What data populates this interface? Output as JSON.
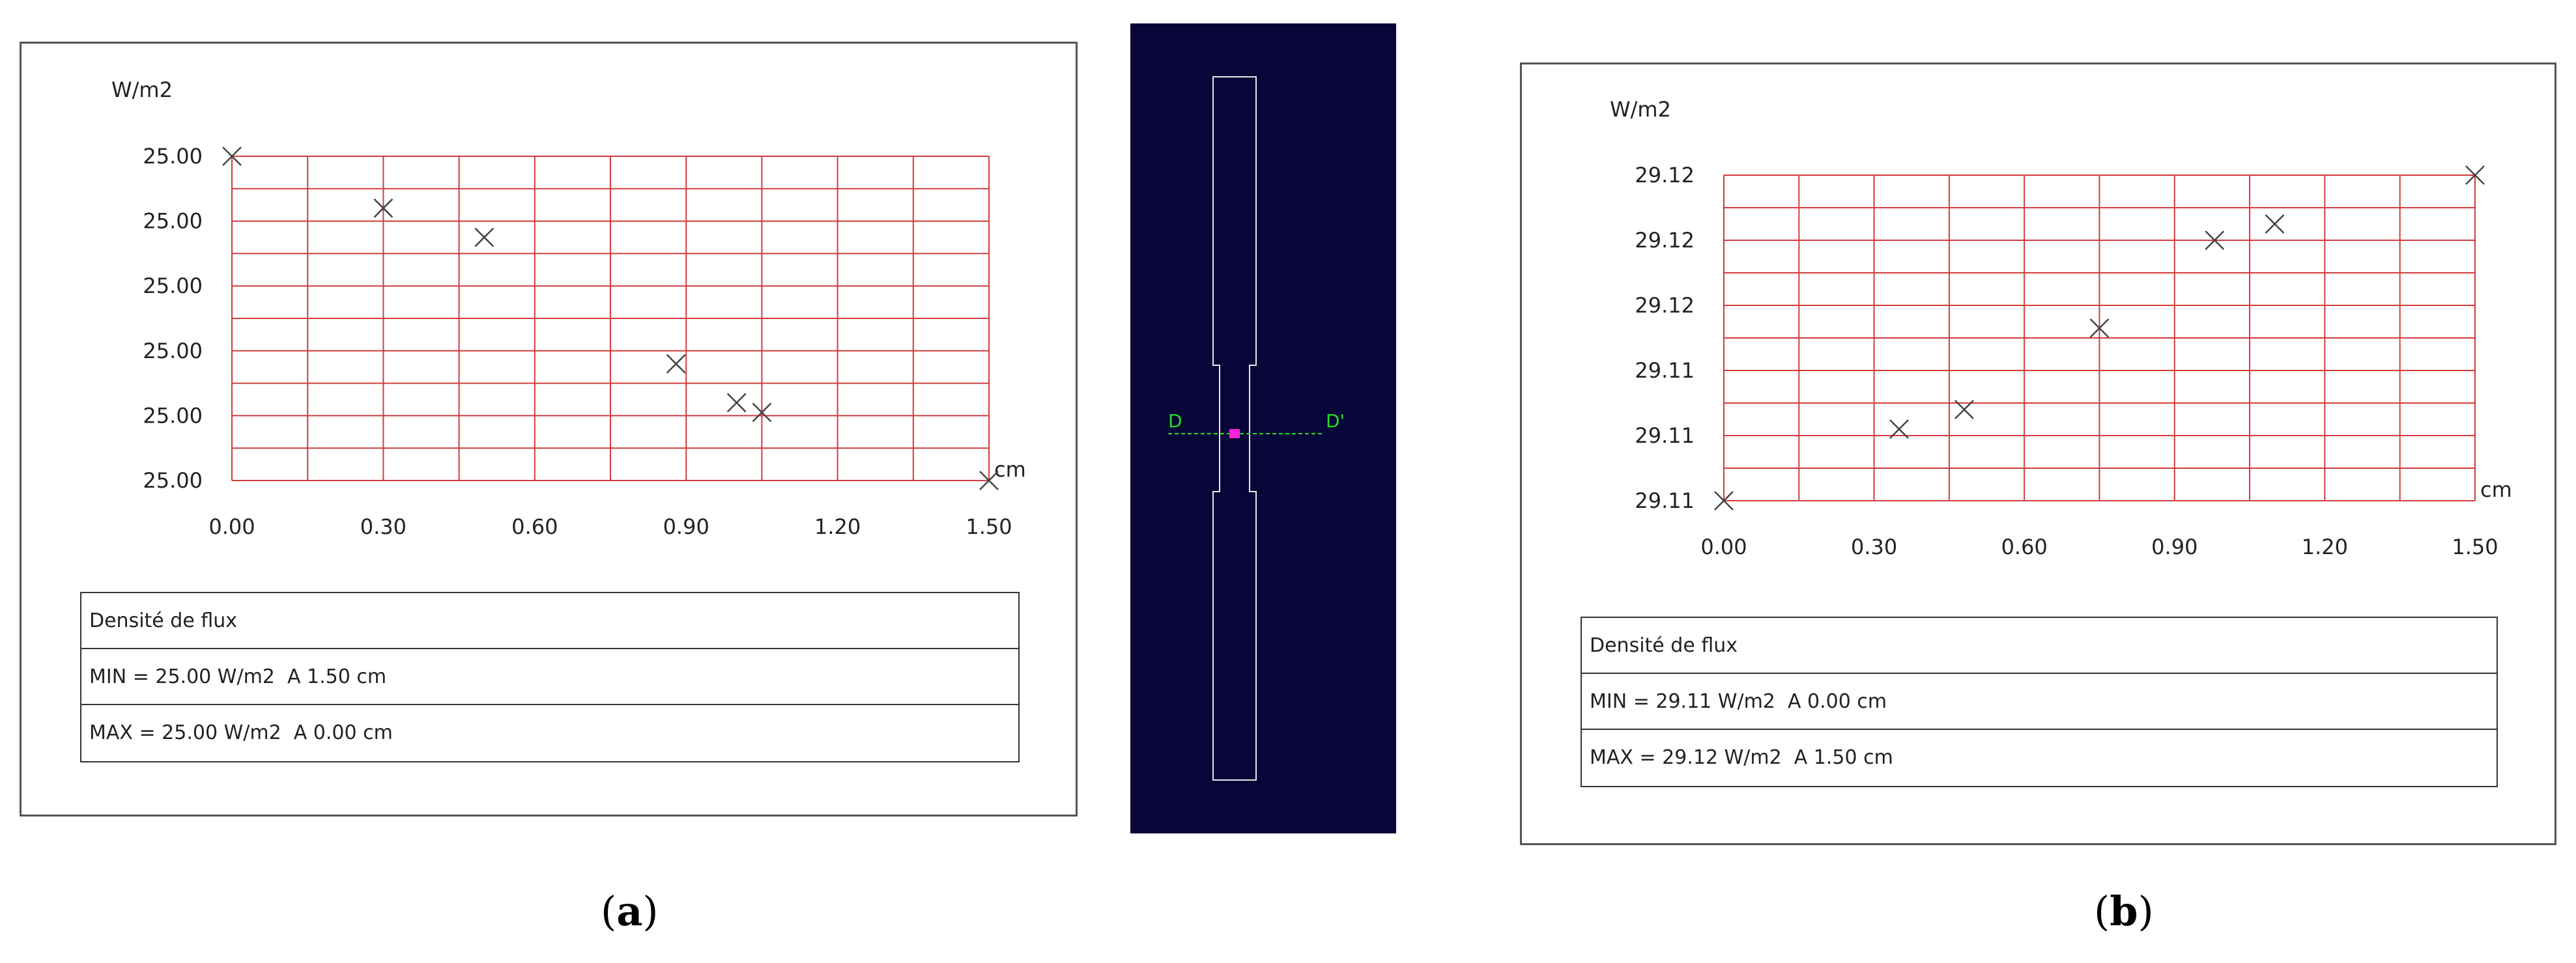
{
  "chart_data": [
    {
      "type": "scatter",
      "title": "",
      "ylabel": "W/m2",
      "xlabel": "cm",
      "xlim": [
        0,
        1.5
      ],
      "x_ticks": [
        "0.00",
        "0.30",
        "0.60",
        "0.90",
        "1.20",
        "1.50"
      ],
      "y_tick_labels": [
        "25.00",
        "25.00",
        "25.00",
        "25.00",
        "25.00",
        "25.00"
      ],
      "series": [
        {
          "marker": "x",
          "points": [
            {
              "x": 0.0,
              "y": 1.0
            },
            {
              "x": 0.3,
              "y": 0.84
            },
            {
              "x": 0.5,
              "y": 0.75
            },
            {
              "x": 0.88,
              "y": 0.36
            },
            {
              "x": 1.0,
              "y": 0.24
            },
            {
              "x": 1.05,
              "y": 0.21
            },
            {
              "x": 1.5,
              "y": 0.0
            }
          ]
        }
      ],
      "grid": true,
      "grid_color": "#d23b3b",
      "marker_color": "#444444",
      "table": {
        "header": "Densité de flux",
        "min": "MIN = 25.00 W/m2  A 1.50 cm",
        "max": "MAX = 25.00 W/m2  A 0.00 cm"
      }
    },
    {
      "type": "scatter",
      "title": "",
      "ylabel": "W/m2",
      "xlabel": "cm",
      "xlim": [
        0,
        1.5
      ],
      "x_ticks": [
        "0.00",
        "0.30",
        "0.60",
        "0.90",
        "1.20",
        "1.50"
      ],
      "y_tick_labels": [
        "29.12",
        "29.12",
        "29.12",
        "29.11",
        "29.11",
        "29.11"
      ],
      "series": [
        {
          "marker": "x",
          "points": [
            {
              "x": 0.0,
              "y": 0.0
            },
            {
              "x": 0.35,
              "y": 0.22
            },
            {
              "x": 0.48,
              "y": 0.28
            },
            {
              "x": 0.75,
              "y": 0.53
            },
            {
              "x": 0.98,
              "y": 0.8
            },
            {
              "x": 1.1,
              "y": 0.85
            },
            {
              "x": 1.5,
              "y": 1.0
            }
          ]
        }
      ],
      "grid": true,
      "grid_color": "#d23b3b",
      "marker_color": "#444444",
      "table": {
        "header": "Densité de flux",
        "min": "MIN = 29.11 W/m2  A 0.00 cm",
        "max": "MAX = 29.12 W/m2  A 1.50 cm"
      }
    }
  ],
  "sample_view": {
    "background": "#080638",
    "outline_color": "#e6e6ee",
    "cut_line_color": "#22dd22",
    "point_color": "#ff22dd",
    "label_start": "D",
    "label_end": "D'"
  },
  "captions": {
    "a": "a",
    "b": "b"
  }
}
